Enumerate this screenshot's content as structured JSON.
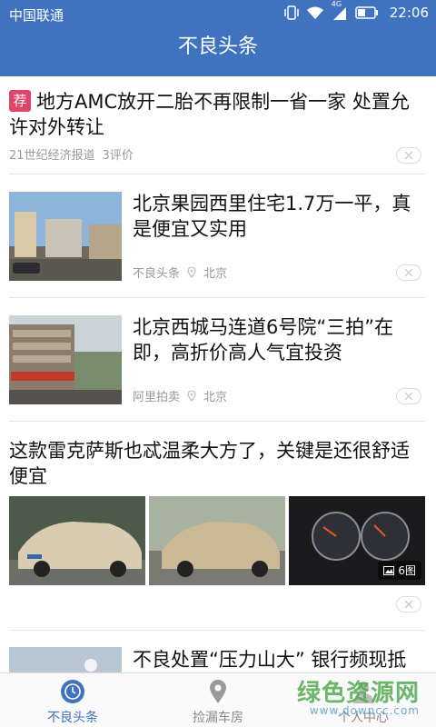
{
  "status_bar": {
    "carrier": "中国联通",
    "network": "4G",
    "time": "22:06"
  },
  "app_bar": {
    "title": "不良头条"
  },
  "feed": [
    {
      "tag": "荐",
      "title": "地方AMC放开二胎不再限制一省一家 处置允许对外转让",
      "source": "21世纪经济报道",
      "comments": "3评价"
    },
    {
      "title": "北京果园西里住宅1.7万一平，真是便宜又实用",
      "source": "不良头条",
      "location": "北京"
    },
    {
      "title": "北京西城马连道6号院“三拍”在即，高折价高人气宜投资",
      "source": "阿里拍卖",
      "location": "北京"
    },
    {
      "title": "这款雷克萨斯也忒温柔大方了，关键是还很舒适便宜",
      "image_count": "6图"
    },
    {
      "title": "不良处置“压力山大” 银行频现抵"
    }
  ],
  "tab_bar": {
    "tabs": [
      {
        "label": "不良头条",
        "icon": "clock-icon",
        "active": true
      },
      {
        "label": "捡漏车房",
        "icon": "location-pin-icon",
        "active": false
      },
      {
        "label": "个人中心",
        "icon": "person-icon",
        "active": false
      }
    ]
  },
  "watermark": {
    "title": "绿色资源网",
    "url": "www.downcc.com"
  },
  "colors": {
    "primary": "#3f73c0",
    "tag": "#e0446a"
  }
}
